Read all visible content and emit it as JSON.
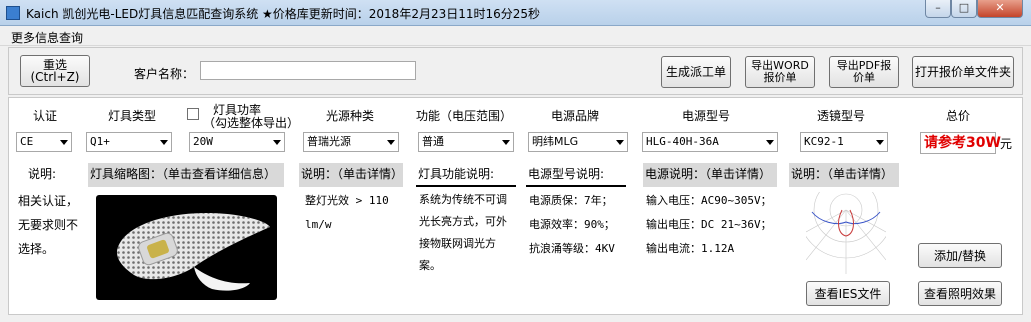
{
  "window": {
    "title": "Kaich 凯创光电-LED灯具信息匹配查询系统   ★价格库更新时间：2018年2月23日11时16分25秒",
    "min_glyph": "–",
    "max_glyph": "□",
    "close_glyph": "✕"
  },
  "menu": {
    "more_info": "更多信息查询"
  },
  "toolbar": {
    "reset_label": "重选\n(Ctrl+Z)",
    "customer_label": "客户名称：",
    "customer_value": "",
    "generate_order": "生成派工单",
    "export_word": "导出WORD报价单",
    "export_pdf": "导出PDF报价单",
    "open_folder": "打开报价单文件夹"
  },
  "headers": {
    "cert": "认证",
    "lamp_type": "灯具类型",
    "power_line1": "灯具功率",
    "power_line2": "（勾选整体导出）",
    "light_source": "光源种类",
    "function": "功能（电压范围）",
    "psu_brand": "电源品牌",
    "psu_model": "电源型号",
    "lens_model": "透镜型号",
    "total_price": "总价"
  },
  "selects": {
    "cert": "CE",
    "lamp_type": "Q1+",
    "power": "20W",
    "light_source": "普瑞光源",
    "function": "普通",
    "psu_brand": "明纬MLG",
    "psu_model": "HLG-40H-36A",
    "lens_model": "KC92-1"
  },
  "price": {
    "value": "请参考30W",
    "unit": "元"
  },
  "sections": {
    "explain": "说明:",
    "thumb": "灯具缩略图：（单击查看详细信息）",
    "light_source_explain": "说明：（单击详情）",
    "function_explain": "灯具功能说明:",
    "psu_model_explain": "电源型号说明:",
    "psu_explain": "电源说明：（单击详情）",
    "lens_explain": "说明：（单击详情）"
  },
  "texts": {
    "cert_explain": "相关认证，\n无要求则不\n选择。",
    "light_source": "整灯光效 > 110\nlm/w",
    "function": "系统为传统不可调\n光长亮方式，可外\n接物联网调光方\n案。",
    "psu_model": "电源质保：7年；\n电源效率：90%；\n抗浪涌等级：4KV",
    "psu": "输入电压：AC90~305V；\n输出电压：DC 21~36V；\n输出电流：1.12A"
  },
  "buttons": {
    "add_replace": "添加/替换",
    "view_ies": "查看IES文件",
    "view_lighting": "查看照明效果"
  }
}
